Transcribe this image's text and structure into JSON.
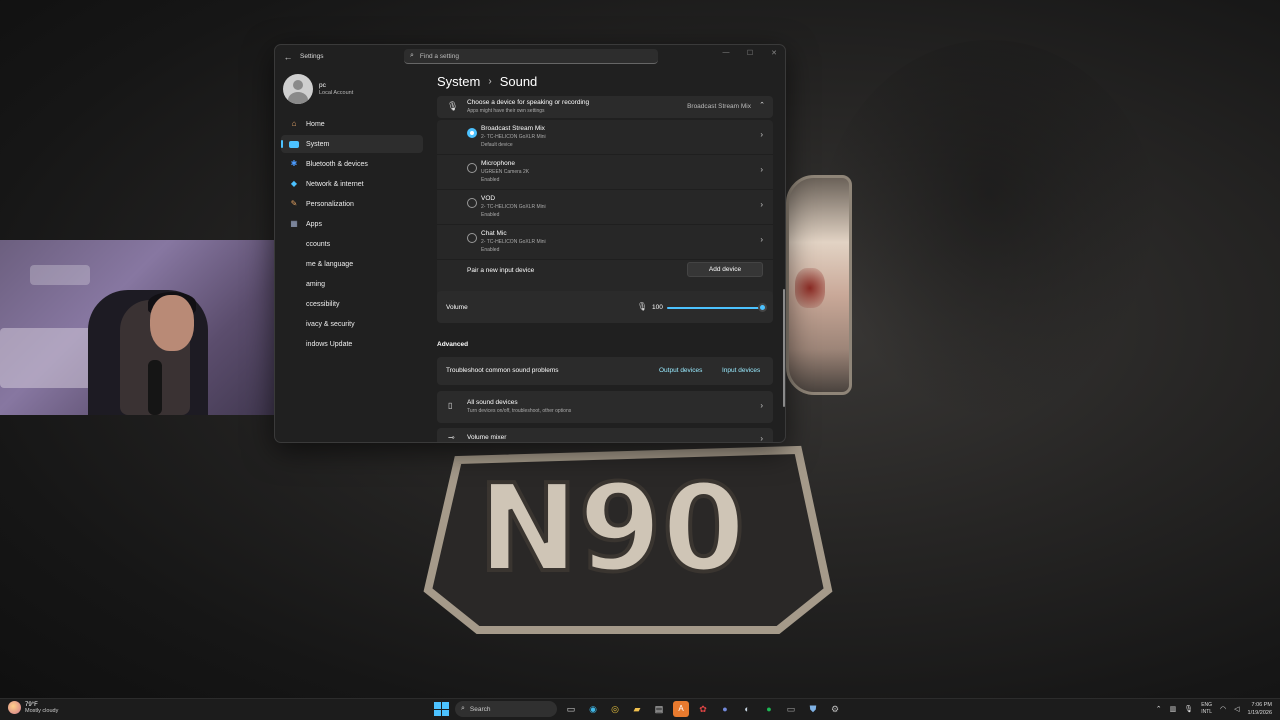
{
  "window": {
    "app_title": "Settings",
    "minimize": "—",
    "maximize": "☐",
    "close": "✕"
  },
  "search": {
    "placeholder": "Find a setting"
  },
  "profile": {
    "name": "pc",
    "account": "Local Account"
  },
  "sidebar": {
    "items": [
      {
        "label": "Home",
        "icon": "home-icon",
        "active": false
      },
      {
        "label": "System",
        "icon": "system-icon",
        "active": true
      },
      {
        "label": "Bluetooth & devices",
        "icon": "bluetooth-icon",
        "active": false
      },
      {
        "label": "Network & internet",
        "icon": "wifi-icon",
        "active": false
      },
      {
        "label": "Personalization",
        "icon": "brush-icon",
        "active": false
      },
      {
        "label": "Apps",
        "icon": "apps-icon",
        "active": false
      },
      {
        "label": "ccounts",
        "icon": "accounts-icon",
        "active": false
      },
      {
        "label": "me & language",
        "icon": "time-icon",
        "active": false
      },
      {
        "label": "aming",
        "icon": "gaming-icon",
        "active": false
      },
      {
        "label": "ccessibility",
        "icon": "accessibility-icon",
        "active": false
      },
      {
        "label": "ivacy & security",
        "icon": "shield-icon",
        "active": false
      },
      {
        "label": "indows Update",
        "icon": "update-icon",
        "active": false
      }
    ]
  },
  "breadcrumb": {
    "parent": "System",
    "current": "Sound"
  },
  "input": {
    "title": "Choose a device for speaking or recording",
    "subtitle": "Apps might have their own settings",
    "selected": "Broadcast Stream Mix",
    "devices": [
      {
        "name": "Broadcast Stream Mix",
        "model": "2- TC-HELICON GoXLR Mini",
        "status": "Default device",
        "selected": true
      },
      {
        "name": "Microphone",
        "model": "UGREEN Camera 2K",
        "status": "Enabled",
        "selected": false
      },
      {
        "name": "VOD",
        "model": "2- TC-HELICON GoXLR Mini",
        "status": "Enabled",
        "selected": false
      },
      {
        "name": "Chat Mic",
        "model": "2- TC-HELICON GoXLR Mini",
        "status": "Enabled",
        "selected": false
      }
    ],
    "pair_label": "Pair a new input device",
    "add_button": "Add device"
  },
  "volume": {
    "label": "Volume",
    "value": "100",
    "level": 1.0
  },
  "advanced": {
    "heading": "Advanced",
    "troubleshoot_label": "Troubleshoot common sound problems",
    "output_link": "Output devices",
    "input_link": "Input devices",
    "all_devices_title": "All sound devices",
    "all_devices_sub": "Turn devices on/off, troubleshoot, other options",
    "mixer_title": "Volume mixer"
  },
  "taskbar": {
    "weather_temp": "79°F",
    "weather_desc": "Mostly cloudy",
    "search_label": "Search",
    "lang_top": "ENG",
    "lang_bottom": "INTL",
    "time": "7:06 PM",
    "date": "1/19/2026",
    "apps": [
      "task-view-icon",
      "edge-icon",
      "chrome-icon",
      "file-explorer-icon",
      "calendar-icon",
      "app-a-icon",
      "app-gear-icon",
      "discord-icon",
      "steam-icon",
      "spotify-icon",
      "terminal-icon",
      "shield-app-icon",
      "settings-icon"
    ]
  },
  "colors": {
    "accent": "#4cc2ff",
    "link": "#99ebff",
    "window_bg": "#202020",
    "card_bg": "#2b2b2b"
  }
}
